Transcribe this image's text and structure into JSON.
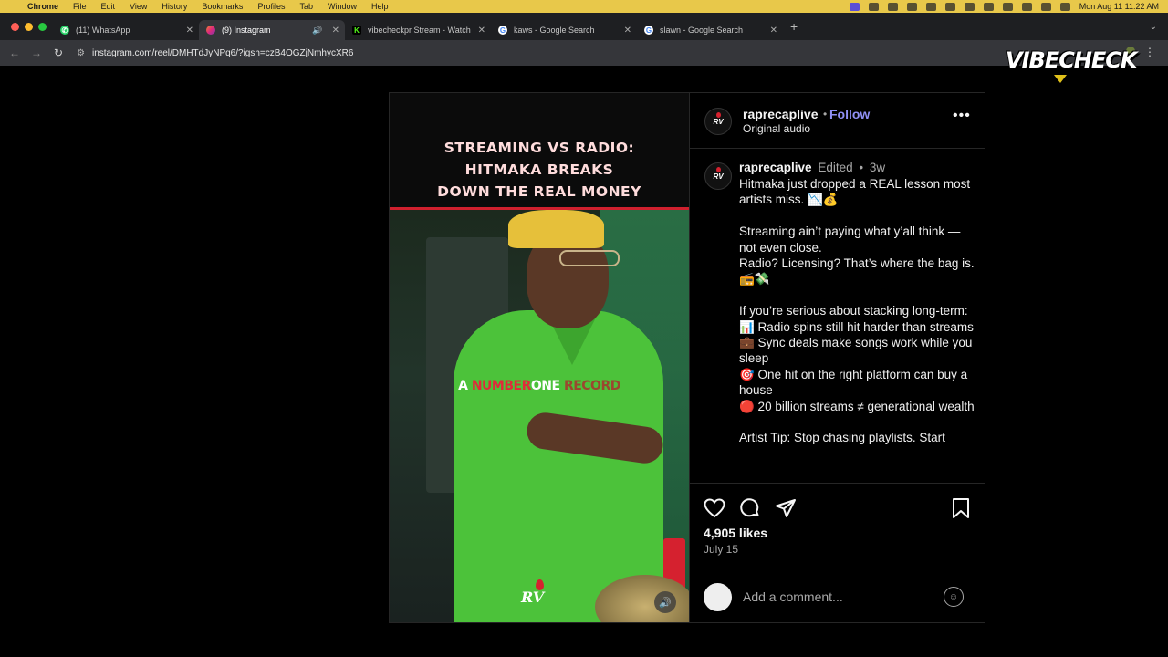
{
  "menubar": {
    "app": "Chrome",
    "items": [
      "File",
      "Edit",
      "View",
      "History",
      "Bookmarks",
      "Profiles",
      "Tab",
      "Window",
      "Help"
    ],
    "clock": "Mon Aug 11  11:22 AM"
  },
  "tabs": [
    {
      "label": "(11) WhatsApp",
      "favicon": "whatsapp-icon",
      "color": "#25d366",
      "active": false
    },
    {
      "label": "(9) Instagram",
      "favicon": "instagram-icon",
      "color": "#e1306c",
      "active": true
    },
    {
      "label": "vibecheckpr Stream - Watch",
      "favicon": "kick-icon",
      "color": "#53fc18",
      "active": false
    },
    {
      "label": "kaws - Google Search",
      "favicon": "google-icon",
      "color": "#4285f4",
      "active": false
    },
    {
      "label": "slawn - Google Search",
      "favicon": "google-icon",
      "color": "#4285f4",
      "active": false
    }
  ],
  "address": {
    "url": "instagram.com/reel/DMHTdJyNPq6/?igsh=czB4OGZjNmhycXR6"
  },
  "overlay": {
    "logo_text": "VIBECHECK",
    "accent": "#e0c11a"
  },
  "video": {
    "headline_lines": [
      "STREAMING VS RADIO:",
      "HITMAKA BREAKS",
      "DOWN THE REAL MONEY"
    ],
    "caption_words": [
      "A",
      "NUMBER",
      "ONE",
      "RECORD"
    ],
    "logo_text": "RV"
  },
  "post": {
    "username": "raprecaplive",
    "follow": "Follow",
    "audio": "Original audio",
    "comment": {
      "username": "raprecaplive",
      "edited": "Edited",
      "separator": "•",
      "age": "3w",
      "lines": [
        "Hitmaka just dropped a REAL lesson most artists miss. 📉💰",
        "",
        "Streaming ain’t paying what y’all think — not even close.",
        "Radio? Licensing? That’s where the bag is. 📻💸",
        "",
        "If you’re serious about stacking long-term:",
        "📊 Radio spins still hit harder than streams",
        "💼 Sync deals make songs work while you sleep",
        "🎯 One hit on the right platform can buy a house",
        "🔴 20 billion streams ≠ generational wealth",
        "",
        "Artist Tip: Stop chasing playlists. Start"
      ]
    },
    "likes": "4,905 likes",
    "date": "July 15",
    "comment_placeholder": "Add a comment..."
  }
}
